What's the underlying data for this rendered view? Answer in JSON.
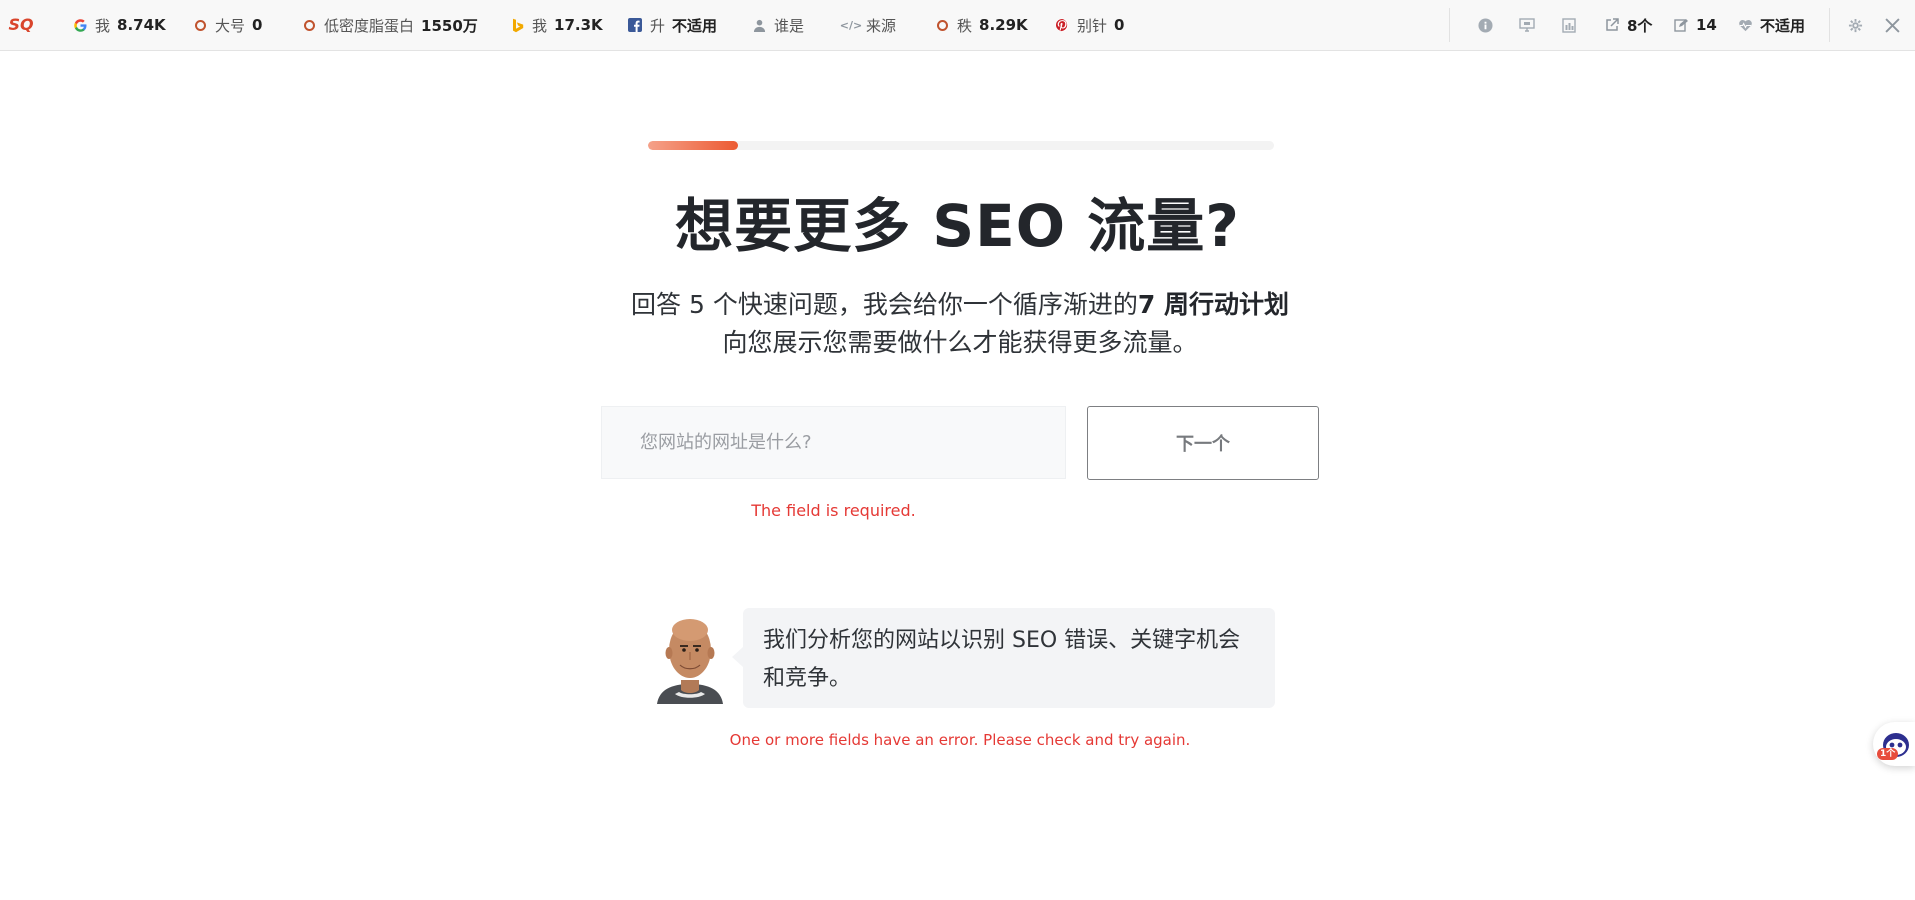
{
  "toolbar": {
    "logo": "SQ",
    "metrics": [
      {
        "icon": "google-icon",
        "label": "我",
        "value": "8.74K"
      },
      {
        "icon": "ring-icon",
        "label": "大号",
        "value": "0"
      },
      {
        "icon": "ring-icon",
        "label": "低密度脂蛋白",
        "value": "1550万"
      },
      {
        "icon": "bing-icon",
        "label": "我",
        "value": "17.3K"
      },
      {
        "icon": "facebook-icon",
        "label": "升",
        "value": "不适用"
      },
      {
        "icon": "person-icon",
        "label": "谁是",
        "value": ""
      },
      {
        "icon": "code-icon",
        "label": "来源",
        "value": ""
      },
      {
        "icon": "ring-icon",
        "label": "秩",
        "value": "8.29K"
      },
      {
        "icon": "pinterest-icon",
        "label": "别针",
        "value": "0"
      }
    ],
    "right": {
      "external_links": "8个",
      "edit_count": "14",
      "health": "不适用"
    }
  },
  "progress": {
    "fraction": 0.143
  },
  "page": {
    "headline": "想要更多 SEO 流量?",
    "subtitle_line1_prefix": "回答 5 个快速问题，我会给你一个循序渐进的",
    "subtitle_line1_bold": "7 周行动计划",
    "subtitle_line2": "向您展示您需要做什么才能获得更多流量。"
  },
  "form": {
    "url_placeholder": "您网站的网址是什么?",
    "url_value": "",
    "next_label": "下一个",
    "required_error": "The field is required.",
    "form_error": "One or more fields have an error. Please check and try again."
  },
  "chat": {
    "message": "我们分析您的网站以识别 SEO 错误、关键字机会和竞争。"
  },
  "widget": {
    "badge": "1个"
  },
  "colors": {
    "accent": "#ec5a32",
    "error": "#e53935",
    "headline": "#23262b"
  }
}
